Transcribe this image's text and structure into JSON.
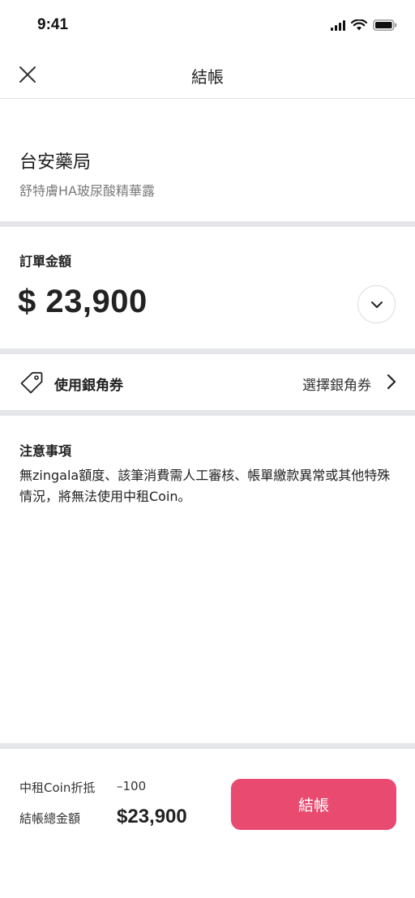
{
  "status_bar": {
    "time": "9:41"
  },
  "nav": {
    "title": "結帳"
  },
  "merchant": {
    "name": "台安藥局",
    "product": "舒特膚HA玻尿酸精華露"
  },
  "order": {
    "label": "訂單金額",
    "amount": "$ 23,900"
  },
  "coupon": {
    "label": "使用銀角券",
    "select_label": "選擇銀角券"
  },
  "notes": {
    "title": "注意事項",
    "body": "無zingala額度、該筆消費需人工審核、帳單繳款異常或其他特殊情況，將無法使用中租Coin。"
  },
  "footer": {
    "coin_label": "中租Coin折抵",
    "coin_value": "–100",
    "total_label": "結帳總金額",
    "total_value": "$23,900",
    "checkout_label": "結帳"
  },
  "colors": {
    "accent": "#e94a6f",
    "divider": "#e4e6ea"
  }
}
